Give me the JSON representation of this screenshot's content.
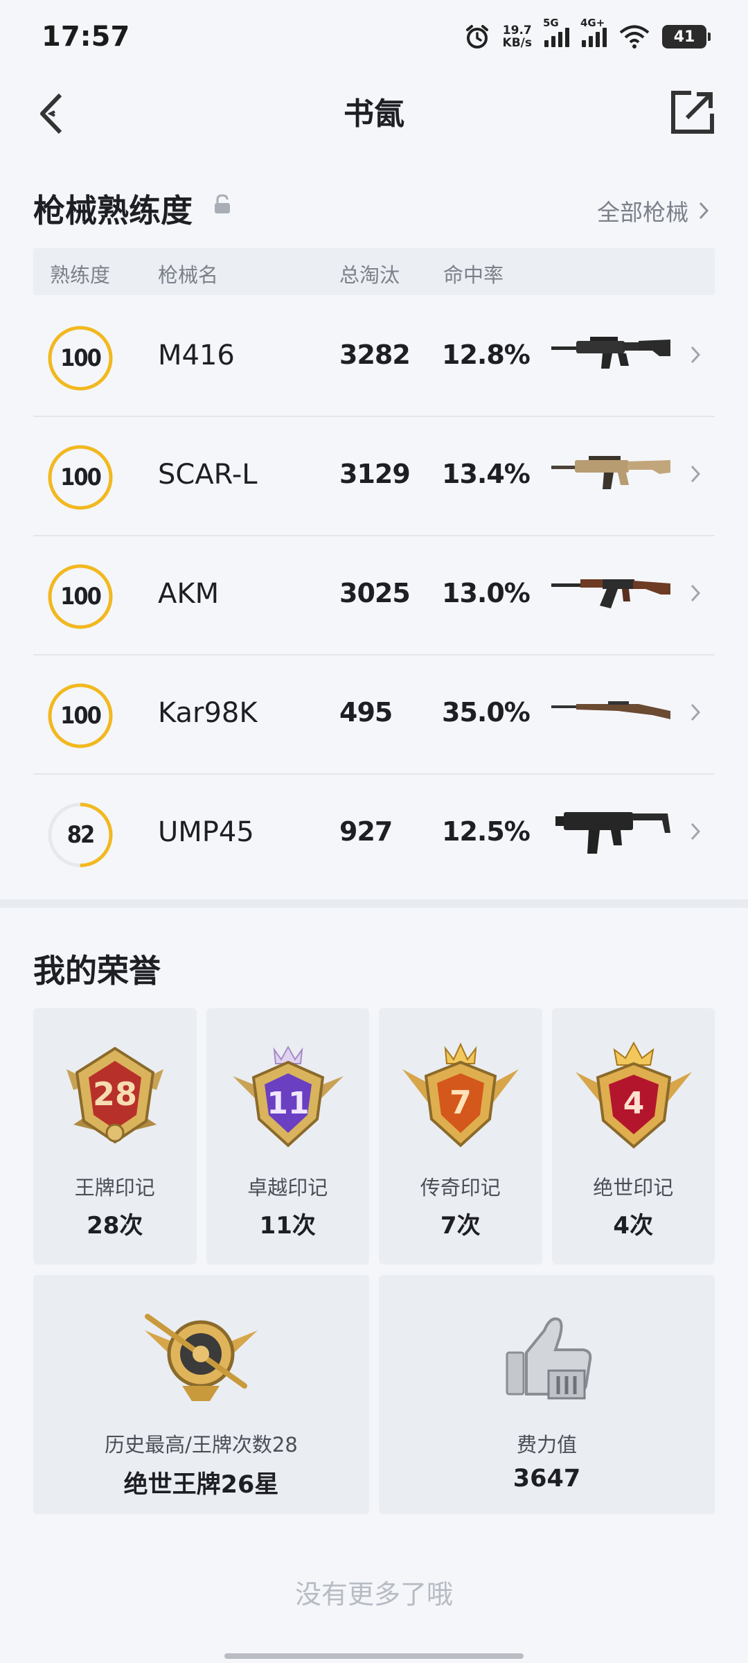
{
  "status_bar": {
    "time": "17:57",
    "speed_value": "19.7",
    "speed_unit": "KB/s",
    "net1": "5G",
    "net2": "4G+",
    "battery": "41"
  },
  "header": {
    "title": "书氤"
  },
  "weapons": {
    "title": "枪械熟练度",
    "all_label": "全部枪械",
    "columns": {
      "proficiency": "熟练度",
      "name": "枪械名",
      "kills": "总淘汰",
      "accuracy": "命中率"
    },
    "items": [
      {
        "level": "100",
        "name": "M416",
        "kills": "3282",
        "accuracy": "12.8%",
        "progress": 1.0,
        "icon": "m416-rifle-icon"
      },
      {
        "level": "100",
        "name": "SCAR-L",
        "kills": "3129",
        "accuracy": "13.4%",
        "progress": 1.0,
        "icon": "scarl-rifle-icon"
      },
      {
        "level": "100",
        "name": "AKM",
        "kills": "3025",
        "accuracy": "13.0%",
        "progress": 1.0,
        "icon": "akm-rifle-icon"
      },
      {
        "level": "100",
        "name": "Kar98K",
        "kills": "495",
        "accuracy": "35.0%",
        "progress": 1.0,
        "icon": "kar98k-sniper-icon"
      },
      {
        "level": "82",
        "name": "UMP45",
        "kills": "927",
        "accuracy": "12.5%",
        "progress": 0.5,
        "icon": "ump45-smg-icon"
      }
    ]
  },
  "honors": {
    "title": "我的荣誉",
    "badges": [
      {
        "number": "28",
        "name": "王牌印记",
        "count": "28次",
        "color": "#b8302a"
      },
      {
        "number": "11",
        "name": "卓越印记",
        "count": "11次",
        "color": "#6a3fc2"
      },
      {
        "number": "7",
        "name": "传奇印记",
        "count": "7次",
        "color": "#d4571c"
      },
      {
        "number": "4",
        "name": "绝世印记",
        "count": "4次",
        "color": "#b3162c"
      }
    ],
    "best": {
      "label": "历史最高/王牌次数28",
      "value": "绝世王牌26星"
    },
    "effort": {
      "label": "费力值",
      "value": "3647"
    }
  },
  "footer": {
    "no_more": "没有更多了哦"
  },
  "colors": {
    "ring": "#f2b81e",
    "ring_track": "#e6e8ec",
    "gold": "#d9a93a"
  }
}
